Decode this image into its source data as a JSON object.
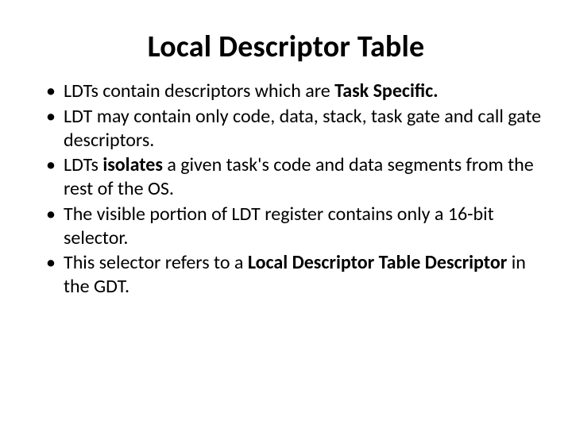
{
  "slide": {
    "title": "Local Descriptor Table",
    "bullets": [
      {
        "pre": "LDTs contain descriptors which are ",
        "bold1": "Task Specific.",
        "mid": "",
        "bold2": "",
        "post": ""
      },
      {
        "pre": "LDT may contain only code, data, stack, task gate and call gate descriptors.",
        "bold1": "",
        "mid": "",
        "bold2": "",
        "post": ""
      },
      {
        "pre": "LDTs ",
        "bold1": "isolates",
        "mid": " a given task's code and data segments from the rest of the OS.",
        "bold2": "",
        "post": ""
      },
      {
        "pre": "The visible portion of LDT register contains only a 16-bit selector.",
        "bold1": "",
        "mid": "",
        "bold2": "",
        "post": ""
      },
      {
        "pre": "This selector refers to a ",
        "bold1": "Local Descriptor Table Descriptor",
        "mid": " in the GDT.",
        "bold2": "",
        "post": ""
      }
    ]
  }
}
